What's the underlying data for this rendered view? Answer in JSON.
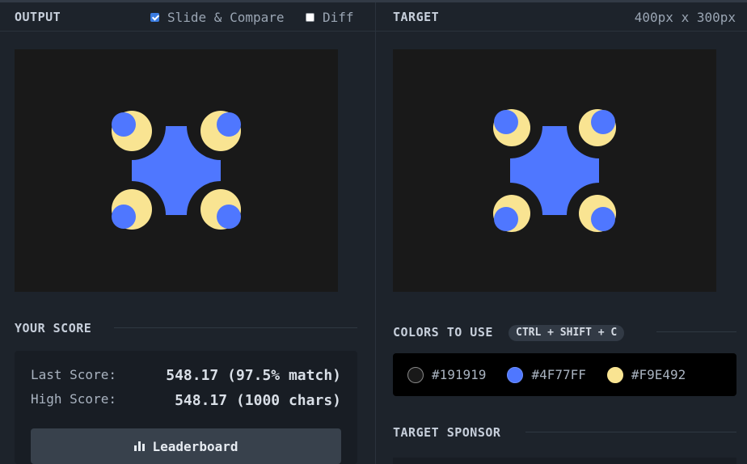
{
  "output": {
    "title": "OUTPUT",
    "slide_compare_label": "Slide & Compare",
    "slide_compare_checked": true,
    "diff_label": "Diff",
    "diff_checked": false
  },
  "target": {
    "title": "TARGET",
    "dimensions": "400px x 300px"
  },
  "score": {
    "title": "YOUR SCORE",
    "last_label": "Last Score:",
    "last_value": "548.17 (97.5% match)",
    "high_label": "High Score:",
    "high_value": "548.17 (1000 chars)",
    "leaderboard_label": "Leaderboard"
  },
  "colors": {
    "title": "COLORS TO USE",
    "shortcut": "CTRL + SHIFT + C",
    "swatches": [
      {
        "hex": "#191919",
        "label": "#191919"
      },
      {
        "hex": "#4F77FF",
        "label": "#4F77FF"
      },
      {
        "hex": "#F9E492",
        "label": "#F9E492"
      }
    ]
  },
  "sponsor": {
    "title": "TARGET SPONSOR"
  }
}
